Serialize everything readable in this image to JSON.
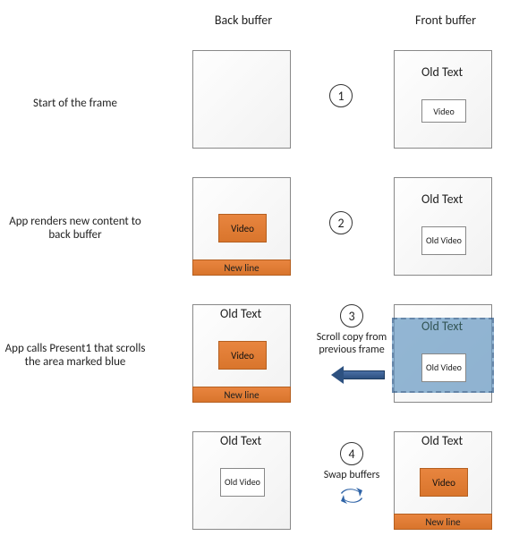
{
  "headers": {
    "back": "Back buffer",
    "front": "Front buffer"
  },
  "rows": {
    "r1": "Start of the frame",
    "r2": "App renders new content to back buffer",
    "r3": "App calls Present1 that scrolls the area marked blue"
  },
  "steps": {
    "s1": "1",
    "s2": "2",
    "s3": "3",
    "s4": "4"
  },
  "mid": {
    "m3": "Scroll copy from previous frame",
    "m4": "Swap buffers"
  },
  "labels": {
    "old_text": "Old Text",
    "video": "Video",
    "old_video": "Old Video",
    "new_line": "New line"
  },
  "chart_data": {
    "type": "table",
    "title": "Swap-buffer scroll/present sequence",
    "steps": [
      {
        "n": 1,
        "description": "Start of the frame",
        "back_buffer": "empty",
        "front_buffer": "Old Text + Video"
      },
      {
        "n": 2,
        "description": "App renders new content to back buffer",
        "back_buffer": "Video (orange) + New line",
        "front_buffer": "Old Text + Old Video"
      },
      {
        "n": 3,
        "description": "App calls Present1 that scrolls the area marked blue — scroll copy from previous frame",
        "back_buffer": "Old Text + Video (orange) + New line",
        "front_buffer": "Old Text + Old Video (blue scrolled region)",
        "arrow": "front → back"
      },
      {
        "n": 4,
        "description": "Swap buffers",
        "back_buffer": "Old Text + Old Video",
        "front_buffer": "Old Text + Video (orange) + New line"
      }
    ]
  }
}
